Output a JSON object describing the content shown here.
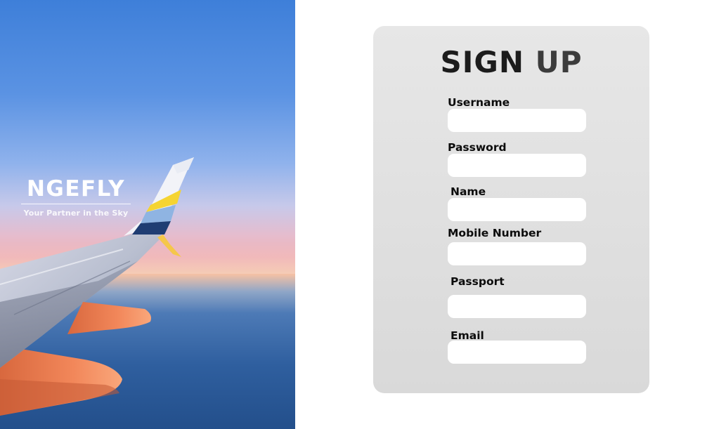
{
  "brand": {
    "name": "NGEFLY",
    "tagline": "Your Partner in the Sky"
  },
  "form": {
    "title_part1": "SIGN",
    "title_part2": "UP",
    "fields": [
      {
        "label": "Username",
        "value": ""
      },
      {
        "label": "Password",
        "value": ""
      },
      {
        "label": "Name",
        "value": ""
      },
      {
        "label": "Mobile Number",
        "value": ""
      },
      {
        "label": "Passport",
        "value": ""
      },
      {
        "label": "Email",
        "value": ""
      }
    ]
  },
  "colors": {
    "card_background": "#dedede",
    "input_background": "#ffffff",
    "title_text": "#1c1c1c",
    "label_text": "#0c0c0c",
    "brand_text": "#ffffff"
  }
}
